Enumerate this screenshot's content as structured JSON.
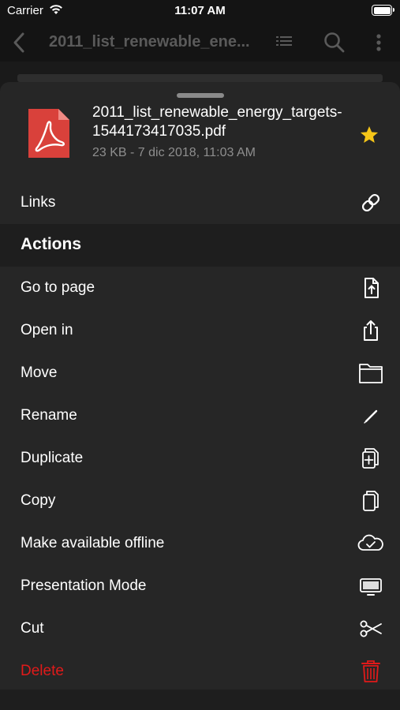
{
  "status_bar": {
    "carrier": "Carrier",
    "time": "11:07 AM"
  },
  "nav": {
    "title": "2011_list_renewable_ene..."
  },
  "file": {
    "name": "2011_list_renewable_energy_targets-1544173417035.pdf",
    "meta": "23 KB - 7 dic 2018, 11:03 AM",
    "starred": true
  },
  "links_row": {
    "label": "Links",
    "icon": "link-icon"
  },
  "actions_header": "Actions",
  "actions": [
    {
      "label": "Go to page",
      "icon": "go-to-page-icon"
    },
    {
      "label": "Open in",
      "icon": "share-icon"
    },
    {
      "label": "Move",
      "icon": "folder-icon"
    },
    {
      "label": "Rename",
      "icon": "pencil-icon"
    },
    {
      "label": "Duplicate",
      "icon": "duplicate-icon"
    },
    {
      "label": "Copy",
      "icon": "copy-icon"
    },
    {
      "label": "Make available offline",
      "icon": "cloud-check-icon"
    },
    {
      "label": "Presentation Mode",
      "icon": "monitor-icon"
    },
    {
      "label": "Cut",
      "icon": "scissors-icon"
    },
    {
      "label": "Delete",
      "icon": "trash-icon"
    }
  ],
  "colors": {
    "sheet": "#262626",
    "section": "#1e1e1e",
    "delete": "#e11a1a",
    "star": "#f5c518",
    "pdf": "#d9413b"
  }
}
